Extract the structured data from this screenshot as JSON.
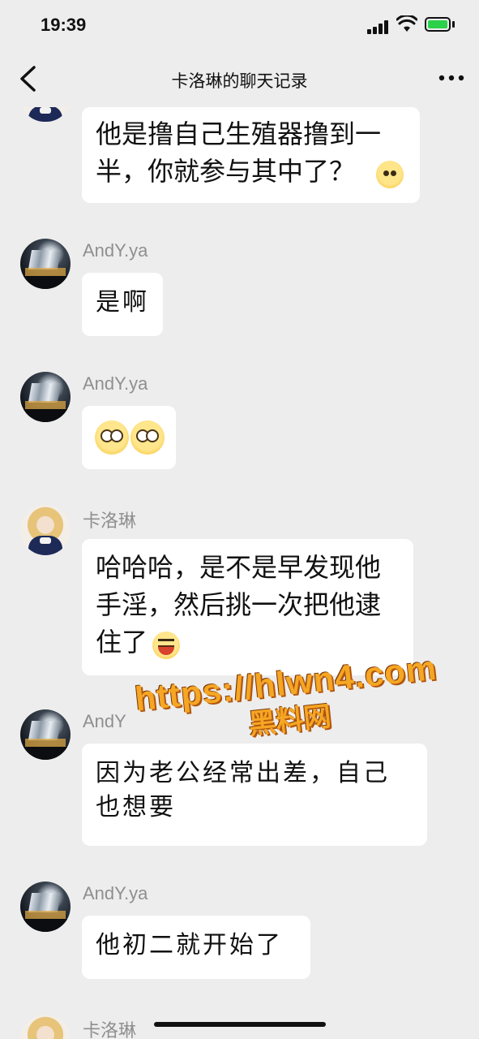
{
  "status_bar": {
    "time": "19:39"
  },
  "nav": {
    "title": "卡洛琳的聊天记录"
  },
  "messages": [
    {
      "sender": "",
      "text": "他是撸自己生殖器撸到一\n半，你就参与其中了？",
      "emoji": "shy-face"
    },
    {
      "sender": "AndY.ya",
      "text": "是啊"
    },
    {
      "sender": "AndY.ya",
      "emoji": "pleading-face x2"
    },
    {
      "sender": "卡洛琳",
      "text": "哈哈哈，是不是早发现他\n手淫，然后挑一次把他逮\n住了",
      "emoji": "laughing-face"
    },
    {
      "sender": "AndY",
      "text": "因为老公经常出差，自己\n也想要"
    },
    {
      "sender": "AndY.ya",
      "text": "他初二就开始了"
    },
    {
      "sender": "卡洛琳"
    }
  ],
  "watermark": {
    "url": "https://hlwn4.com",
    "label": "黑料网"
  },
  "colors": {
    "background": "#ededed",
    "bubble": "#ffffff",
    "name": "#8f8f8f",
    "battery": "#2bd149"
  }
}
